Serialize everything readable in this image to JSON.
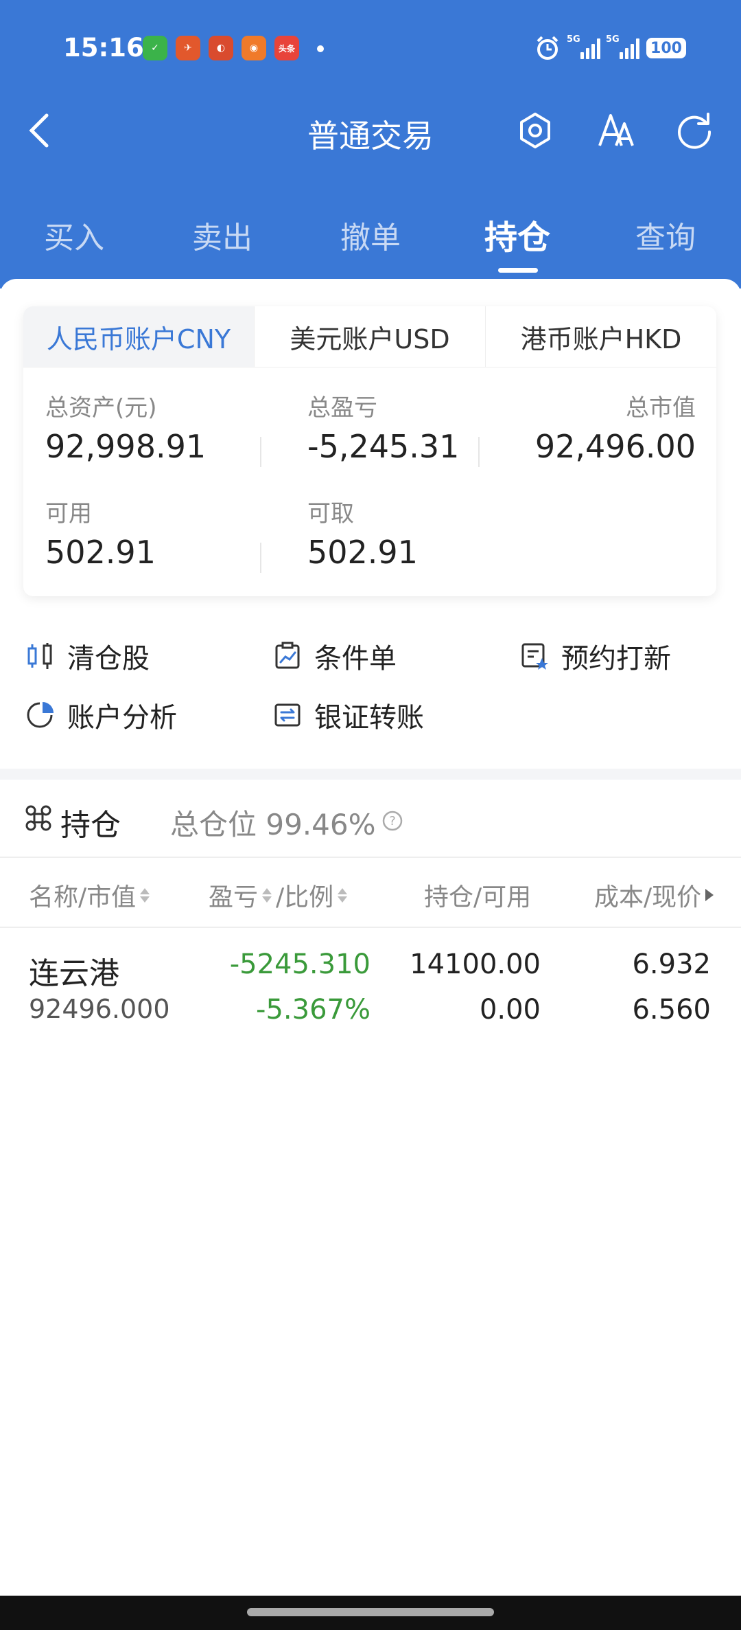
{
  "status": {
    "time": "15:16",
    "apps": [
      {
        "name": "wechat-icon",
        "color": "#3bb34a",
        "glyph": "✓"
      },
      {
        "name": "app-red-icon",
        "color": "#e2582c",
        "glyph": "✈"
      },
      {
        "name": "app-drum-icon",
        "color": "#d94b2e",
        "glyph": "◐"
      },
      {
        "name": "app-orange-icon",
        "color": "#f07a2a",
        "glyph": "◉"
      },
      {
        "name": "toutiao-icon",
        "color": "#e8443a",
        "glyph": "头条"
      }
    ],
    "net1": "5G",
    "net2": "5G",
    "battery": "100"
  },
  "nav": {
    "title": "普通交易"
  },
  "tabs": [
    "买入",
    "卖出",
    "撤单",
    "持仓",
    "查询"
  ],
  "account_tabs": [
    "人民币账户CNY",
    "美元账户USD",
    "港币账户HKD"
  ],
  "summary": {
    "total_assets_label": "总资产(元)",
    "total_assets": "92,998.91",
    "total_pl_label": "总盈亏",
    "total_pl": "-5,245.31",
    "market_value_label": "总市值",
    "market_value": "92,496.00",
    "available_label": "可用",
    "available": "502.91",
    "withdrawable_label": "可取",
    "withdrawable": "502.91"
  },
  "shortcuts": {
    "clear": "清仓股",
    "conditional": "条件单",
    "ipo": "预约打新",
    "analysis": "账户分析",
    "transfer": "银证转账"
  },
  "positions": {
    "title": "持仓",
    "total_position_label": "总仓位 99.46%",
    "columns": [
      "名称/市值",
      "盈亏",
      "/比例",
      "持仓/可用",
      "成本/现价"
    ],
    "rows": [
      {
        "name": "连云港",
        "market_value": "92496.000",
        "pl": "-5245.310",
        "ratio": "-5.367%",
        "hold": "14100.00",
        "avail": "0.00",
        "cost": "6.932",
        "price": "6.560"
      }
    ]
  },
  "colors": {
    "primary": "#3a78d6",
    "loss": "#3a9a3a"
  }
}
